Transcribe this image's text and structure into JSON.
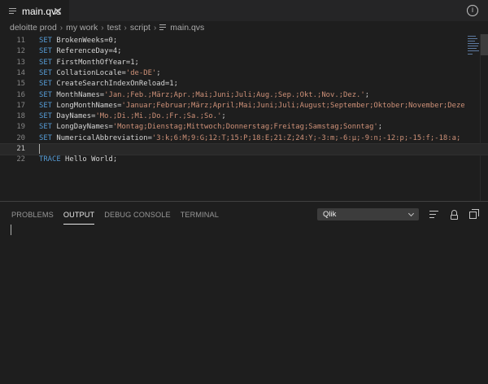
{
  "tab": {
    "label": "main.qvs",
    "close": "✕"
  },
  "breadcrumb": [
    "deloitte prod",
    "my work",
    "test",
    "script"
  ],
  "breadcrumb_file": "main.qvs",
  "editor": {
    "lines": [
      {
        "n": "11",
        "tokens": [
          {
            "t": "SET",
            "c": "kw"
          },
          {
            "t": " BrokenWeeks=0;",
            "c": ""
          }
        ]
      },
      {
        "n": "12",
        "tokens": [
          {
            "t": "SET",
            "c": "kw"
          },
          {
            "t": " ReferenceDay=4;",
            "c": ""
          }
        ]
      },
      {
        "n": "13",
        "tokens": [
          {
            "t": "SET",
            "c": "kw"
          },
          {
            "t": " FirstMonthOfYear=1;",
            "c": ""
          }
        ]
      },
      {
        "n": "14",
        "tokens": [
          {
            "t": "SET",
            "c": "kw"
          },
          {
            "t": " CollationLocale=",
            "c": ""
          },
          {
            "t": "'de-DE'",
            "c": "str"
          },
          {
            "t": ";",
            "c": ""
          }
        ]
      },
      {
        "n": "15",
        "tokens": [
          {
            "t": "SET",
            "c": "kw"
          },
          {
            "t": " CreateSearchIndexOnReload=1;",
            "c": ""
          }
        ]
      },
      {
        "n": "16",
        "tokens": [
          {
            "t": "SET",
            "c": "kw"
          },
          {
            "t": " MonthNames=",
            "c": ""
          },
          {
            "t": "'Jan.;Feb.;März;Apr.;Mai;Juni;Juli;Aug.;Sep.;Okt.;Nov.;Dez.'",
            "c": "str"
          },
          {
            "t": ";",
            "c": ""
          }
        ]
      },
      {
        "n": "17",
        "tokens": [
          {
            "t": "SET",
            "c": "kw"
          },
          {
            "t": " LongMonthNames=",
            "c": ""
          },
          {
            "t": "'Januar;Februar;März;April;Mai;Juni;Juli;August;September;Oktober;November;Deze",
            "c": "str"
          }
        ]
      },
      {
        "n": "18",
        "tokens": [
          {
            "t": "SET",
            "c": "kw"
          },
          {
            "t": " DayNames=",
            "c": ""
          },
          {
            "t": "'Mo.;Di.;Mi.;Do.;Fr.;Sa.;So.'",
            "c": "str"
          },
          {
            "t": ";",
            "c": ""
          }
        ]
      },
      {
        "n": "19",
        "tokens": [
          {
            "t": "SET",
            "c": "kw"
          },
          {
            "t": " LongDayNames=",
            "c": ""
          },
          {
            "t": "'Montag;Dienstag;Mittwoch;Donnerstag;Freitag;Samstag;Sonntag'",
            "c": "str"
          },
          {
            "t": ";",
            "c": ""
          }
        ]
      },
      {
        "n": "20",
        "tokens": [
          {
            "t": "SET",
            "c": "kw"
          },
          {
            "t": " NumericalAbbreviation=",
            "c": ""
          },
          {
            "t": "'3:k;6:M;9:G;12:T;15:P;18:E;21:Z;24:Y;-3:m;-6:µ;-9:n;-12:p;-15:f;-18:a;",
            "c": "str"
          }
        ]
      },
      {
        "n": "21",
        "tokens": []
      },
      {
        "n": "22",
        "tokens": [
          {
            "t": "TRACE",
            "c": "kw"
          },
          {
            "t": " Hello World;",
            "c": ""
          }
        ]
      }
    ],
    "current_line": "21"
  },
  "panel": {
    "tabs": [
      "PROBLEMS",
      "OUTPUT",
      "DEBUG CONSOLE",
      "TERMINAL"
    ],
    "active_tab": "OUTPUT",
    "channel": "Qlik"
  },
  "icons": {
    "account": "account-icon",
    "clear": "clear-output-icon",
    "lock": "lock-scroll-icon",
    "maximize": "maximize-panel-icon"
  },
  "colors": {
    "keyword": "#569cd6",
    "string": "#ce9178",
    "background": "#1e1e1e"
  }
}
